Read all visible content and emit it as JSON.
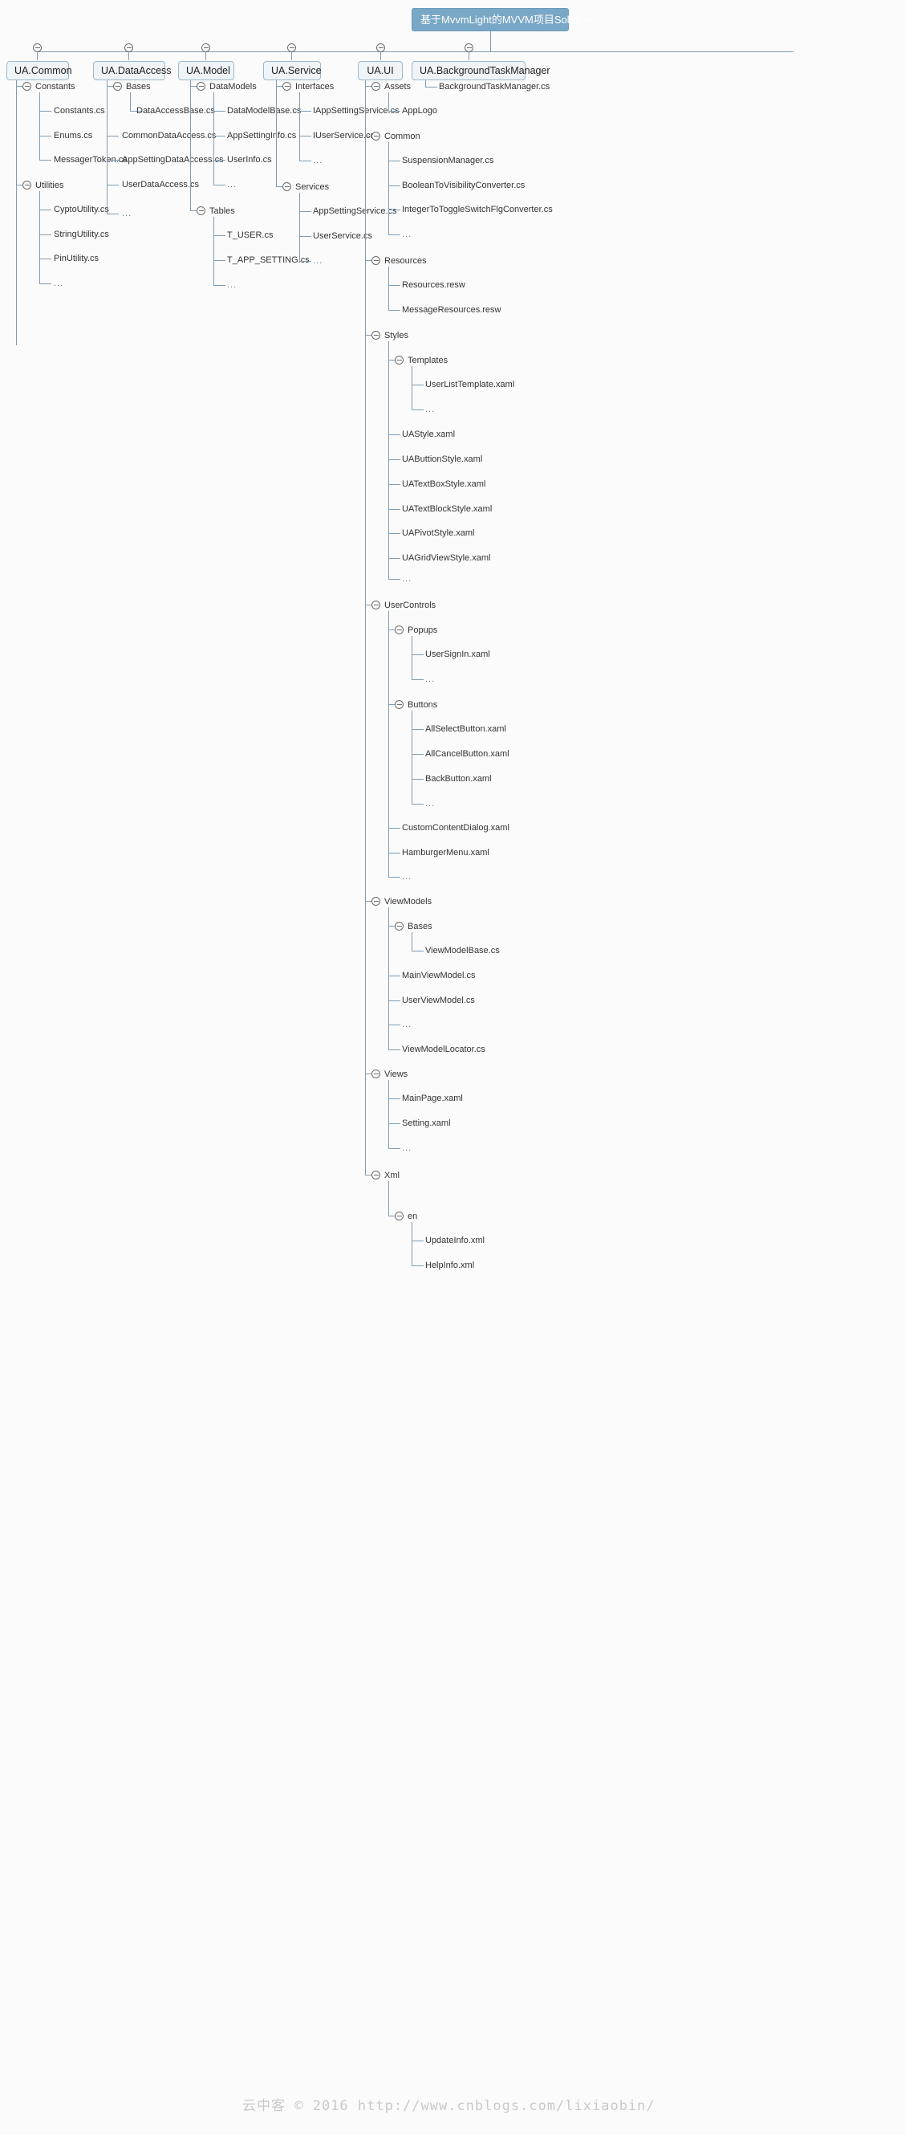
{
  "diagram": {
    "title": "基于MvvmLight的MVVM项目Solution",
    "accent_color": "#79a7c6",
    "node_fill": "#eef4f8",
    "line_color": "#7f9cb5",
    "ellipsis": "...",
    "projects": [
      {
        "name": "UA.Common",
        "children": [
          {
            "name": "Constants",
            "children": [
              "Constants.cs",
              "Enums.cs",
              "MessagerToken.cs"
            ]
          },
          {
            "name": "Utilities",
            "children": [
              "CyptoUtility.cs",
              "StringUtility.cs",
              "PinUtility.cs",
              "..."
            ]
          }
        ]
      },
      {
        "name": "UA.DataAccess",
        "children": [
          {
            "name": "Bases",
            "children": [
              "DataAccessBase.cs"
            ]
          },
          {
            "name": "CommonDataAccess.cs"
          },
          {
            "name": "AppSettingDataAccess.cs"
          },
          {
            "name": "UserDataAccess.cs"
          },
          {
            "name": "..."
          }
        ]
      },
      {
        "name": "UA.Model",
        "children": [
          {
            "name": "DataModels",
            "children": [
              "DataModelBase.cs",
              "AppSettingInfo.cs",
              "UserInfo.cs",
              "..."
            ]
          },
          {
            "name": "Tables",
            "children": [
              "T_USER.cs",
              "T_APP_SETTING.cs",
              "..."
            ]
          }
        ]
      },
      {
        "name": "UA.Service",
        "children": [
          {
            "name": "Interfaces",
            "children": [
              "IAppSettingService.cs",
              "IUserService.cs",
              "..."
            ]
          },
          {
            "name": "Services",
            "children": [
              "AppSettingService.cs",
              "UserService.cs",
              "..."
            ]
          }
        ]
      },
      {
        "name": "UA.UI",
        "children": [
          {
            "name": "Assets",
            "children": [
              "AppLogo"
            ]
          },
          {
            "name": "Common",
            "children": [
              "SuspensionManager.cs",
              "BooleanToVisibilityConverter.cs",
              "IntegerToToggleSwitchFlgConverter.cs",
              "..."
            ]
          },
          {
            "name": "Resources",
            "children": [
              "Resources.resw",
              "MessageResources.resw"
            ]
          },
          {
            "name": "Styles",
            "children": [
              {
                "name": "Templates",
                "children": [
                  "UserListTemplate.xaml",
                  "..."
                ]
              },
              "UAStyle.xaml",
              "UAButtionStyle.xaml",
              "UATextBoxStyle.xaml",
              "UATextBlockStyle.xaml",
              "UAPivotStyle.xaml",
              "UAGridViewStyle.xaml",
              "..."
            ]
          },
          {
            "name": "UserControls",
            "children": [
              {
                "name": "Popups",
                "children": [
                  "UserSignIn.xaml",
                  "..."
                ]
              },
              {
                "name": "Buttons",
                "children": [
                  "AllSelectButton.xaml",
                  "AllCancelButton.xaml",
                  "BackButton.xaml",
                  "..."
                ]
              },
              "CustomContentDialog.xaml",
              "HamburgerMenu.xaml",
              "..."
            ]
          },
          {
            "name": "ViewModels",
            "children": [
              {
                "name": "Bases",
                "children": [
                  "ViewModelBase.cs"
                ]
              },
              "MainViewModel.cs",
              "UserViewModel.cs",
              "...",
              "ViewModelLocator.cs"
            ]
          },
          {
            "name": "Views",
            "children": [
              "MainPage.xaml",
              "Setting.xaml",
              "..."
            ]
          },
          {
            "name": "Xml",
            "children": [
              {
                "name": "en",
                "children": [
                  "UpdateInfo.xml",
                  "HelpInfo.xml"
                ]
              }
            ]
          }
        ]
      },
      {
        "name": "UA.BackgroundTaskManager",
        "children": [
          {
            "name": "BackgroundTaskManager.cs"
          }
        ]
      }
    ]
  },
  "watermark": {
    "text": "云中客 © 2016  http://www.cnblogs.com/lixiaobin/"
  },
  "nodes": {
    "root_label": "基于MvvmLight的MVVM项目Solution",
    "p1": "UA.Common",
    "p2": "UA.DataAccess",
    "p3": "UA.Model",
    "p4": "UA.Service",
    "p5": "UA.UI",
    "p6": "UA.BackgroundTaskManager",
    "c1_constants": "Constants",
    "c1_constants_cs": "Constants.cs",
    "c1_enums_cs": "Enums.cs",
    "c1_messagertoken_cs": "MessagerToken.cs",
    "c1_utilities": "Utilities",
    "c1_cypto": "CyptoUtility.cs",
    "c1_string": "StringUtility.cs",
    "c1_pin": "PinUtility.cs",
    "c1_more": "...",
    "c2_bases": "Bases",
    "c2_dab": "DataAccessBase.cs",
    "c2_common": "CommonDataAccess.cs",
    "c2_appsetting": "AppSettingDataAccess.cs",
    "c2_user": "UserDataAccess.cs",
    "c2_more": "...",
    "c3_datamodels": "DataModels",
    "c3_dmb": "DataModelBase.cs",
    "c3_asi": "AppSettingInfo.cs",
    "c3_ui": "UserInfo.cs",
    "c3_dm_more": "...",
    "c3_tables": "Tables",
    "c3_tuser": "T_USER.cs",
    "c3_tapp": "T_APP_SETTING.cs",
    "c3_t_more": "...",
    "c4_interfaces": "Interfaces",
    "c4_iapp": "IAppSettingService.cs",
    "c4_iuser": "IUserService.cs",
    "c4_i_more": "...",
    "c4_services": "Services",
    "c4_app": "AppSettingService.cs",
    "c4_user": "UserService.cs",
    "c4_s_more": "...",
    "c5_assets": "Assets",
    "c5_applogo": "AppLogo",
    "c5_common": "Common",
    "c5_suspension": "SuspensionManager.cs",
    "c5_b2v": "BooleanToVisibilityConverter.cs",
    "c5_i2t": "IntegerToToggleSwitchFlgConverter.cs",
    "c5_common_more": "...",
    "c5_resources": "Resources",
    "c5_resw1": "Resources.resw",
    "c5_resw2": "MessageResources.resw",
    "c5_styles": "Styles",
    "c5_templates": "Templates",
    "c5_userlisttpl": "UserListTemplate.xaml",
    "c5_tpl_more": "...",
    "c5_uastyle": "UAStyle.xaml",
    "c5_uabutton": "UAButtionStyle.xaml",
    "c5_uatextbox": "UATextBoxStyle.xaml",
    "c5_uatextblock": "UATextBlockStyle.xaml",
    "c5_uapivot": "UAPivotStyle.xaml",
    "c5_uagrid": "UAGridViewStyle.xaml",
    "c5_styles_more": "...",
    "c5_usercontrols": "UserControls",
    "c5_popups": "Popups",
    "c5_usersignin": "UserSignIn.xaml",
    "c5_popups_more": "...",
    "c5_buttons": "Buttons",
    "c5_allselect": "AllSelectButton.xaml",
    "c5_allcancel": "AllCancelButton.xaml",
    "c5_back": "BackButton.xaml",
    "c5_buttons_more": "...",
    "c5_ccd": "CustomContentDialog.xaml",
    "c5_hamburger": "HamburgerMenu.xaml",
    "c5_uc_more": "...",
    "c5_viewmodels": "ViewModels",
    "c5_vm_bases": "Bases",
    "c5_vmbase": "ViewModelBase.cs",
    "c5_mainvm": "MainViewModel.cs",
    "c5_uservm": "UserViewModel.cs",
    "c5_vm_more": "...",
    "c5_vmlocator": "ViewModelLocator.cs",
    "c5_views": "Views",
    "c5_mainpage": "MainPage.xaml",
    "c5_setting": "Setting.xaml",
    "c5_views_more": "...",
    "c5_xml": "Xml",
    "c5_en": "en",
    "c5_updateinfo": "UpdateInfo.xml",
    "c5_helpinfo": "HelpInfo.xml",
    "c6_btm": "BackgroundTaskManager.cs"
  }
}
